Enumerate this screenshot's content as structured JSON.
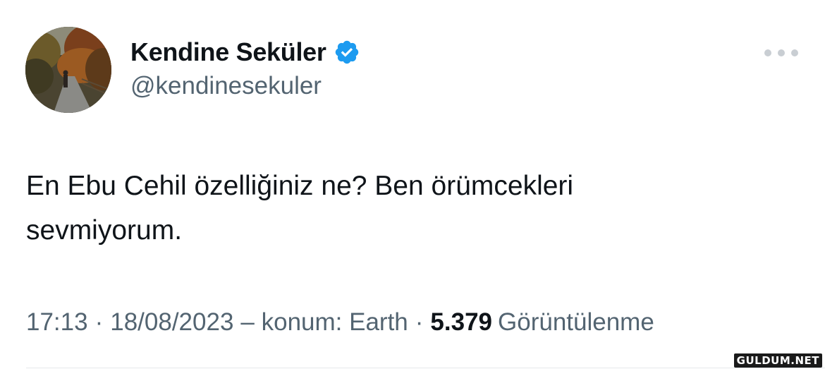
{
  "author": {
    "display_name": "Kendine Seküler",
    "handle": "@kendinesekuler",
    "verified": true,
    "avatar_icon": "profile-photo-autumn-path",
    "verified_color": "#1d9bf0"
  },
  "header": {
    "more_icon": "more-options-icon"
  },
  "tweet": {
    "text": "En Ebu Cehil özelliğiniz ne? Ben örümcekleri\nsevmiyorum."
  },
  "meta": {
    "time": "17:13",
    "separator_dot": "·",
    "date": "18/08/2023",
    "location": "– konum: Earth",
    "views_count": "5.379",
    "views_label": "Görüntülenme"
  },
  "watermark": {
    "text": "GULDUM.NET"
  }
}
